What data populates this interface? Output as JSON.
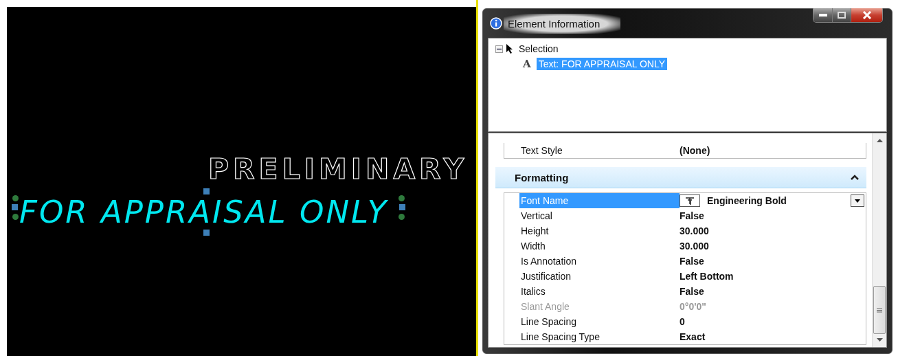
{
  "drawing": {
    "texts": [
      {
        "kind": "outline",
        "text": "PRELIMINARY",
        "selected": false
      },
      {
        "kind": "filled",
        "text": "FOR APPRAISAL ONLY",
        "selected": true
      }
    ]
  },
  "dialog": {
    "title": "Element Information",
    "tree": {
      "label": "Selection",
      "expanded": true,
      "children": [
        {
          "glyph": "A",
          "label": "Text: FOR APPRAISAL ONLY",
          "selected": true
        }
      ]
    },
    "general_rows": [
      {
        "label": "Text Style",
        "value": "(None)",
        "selected": false,
        "disabled": false
      }
    ],
    "section": {
      "title": "Formatting",
      "expanded": true,
      "rows": [
        {
          "kind": "dropdown",
          "label": "Font Name",
          "value": "Engineering Bold",
          "selected": true,
          "disabled": false
        },
        {
          "kind": "plain",
          "label": "Vertical",
          "value": "False",
          "selected": false,
          "disabled": false
        },
        {
          "kind": "plain",
          "label": "Height",
          "value": "30.000",
          "selected": false,
          "disabled": false
        },
        {
          "kind": "plain",
          "label": "Width",
          "value": "30.000",
          "selected": false,
          "disabled": false
        },
        {
          "kind": "plain",
          "label": "Is Annotation",
          "value": "False",
          "selected": false,
          "disabled": false
        },
        {
          "kind": "plain",
          "label": "Justification",
          "value": "Left Bottom",
          "selected": false,
          "disabled": false
        },
        {
          "kind": "plain",
          "label": "Italics",
          "value": "False",
          "selected": false,
          "disabled": false
        },
        {
          "kind": "plain",
          "label": "Slant Angle",
          "value": "0°0'0\"",
          "selected": false,
          "disabled": true
        },
        {
          "kind": "plain",
          "label": "Line Spacing",
          "value": "0",
          "selected": false,
          "disabled": false
        },
        {
          "kind": "plain",
          "label": "Line Spacing Type",
          "value": "Exact",
          "selected": false,
          "disabled": false
        }
      ]
    }
  }
}
